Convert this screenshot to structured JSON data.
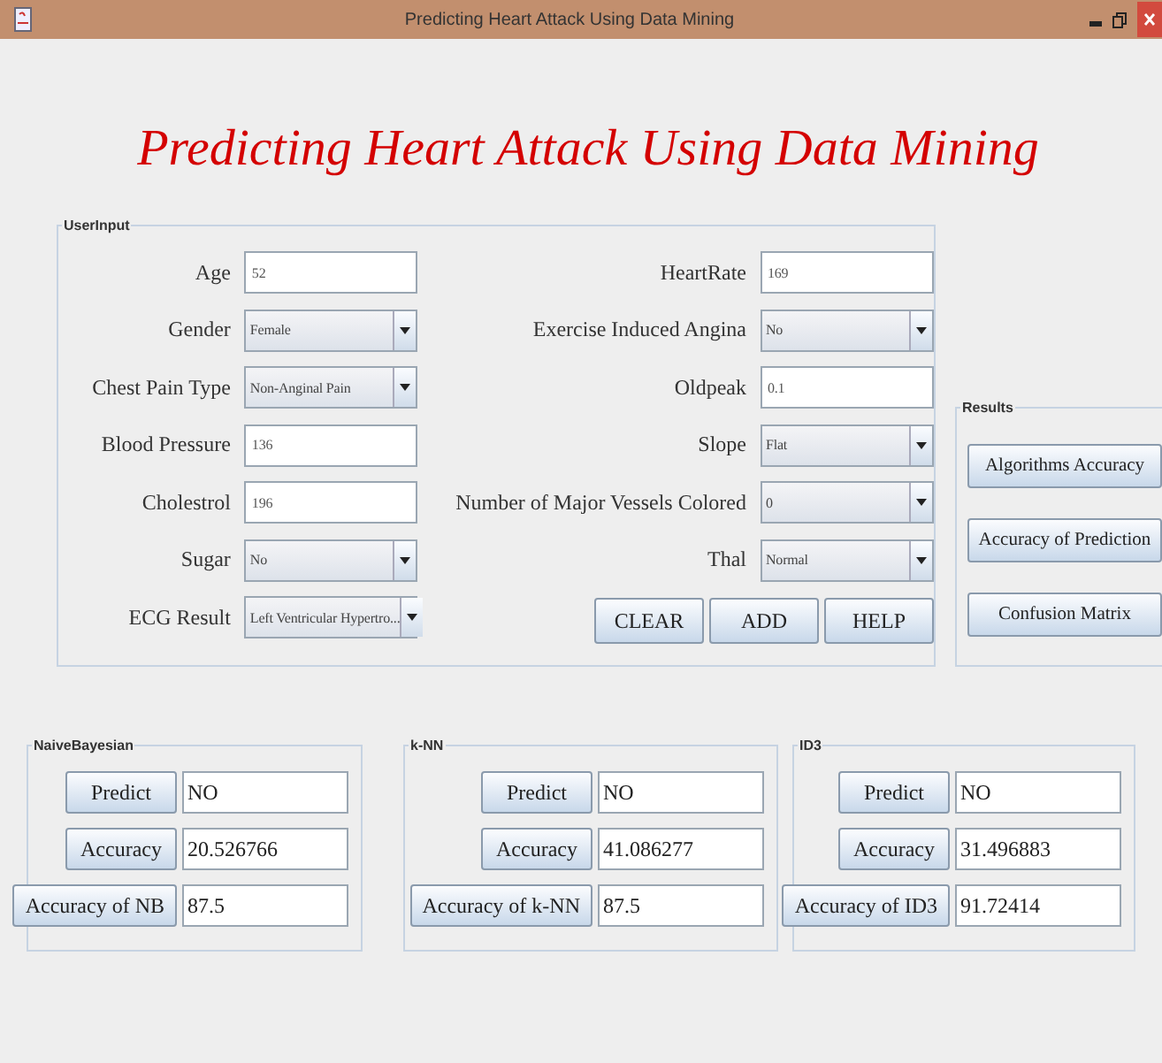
{
  "window": {
    "title": "Predicting Heart Attack Using Data Mining"
  },
  "heading": "Predicting Heart Attack Using Data Mining",
  "user_input": {
    "legend": "UserInput",
    "left_fields": [
      {
        "label": "Age",
        "kind": "text",
        "value": "52"
      },
      {
        "label": "Gender",
        "kind": "select",
        "value": "Female"
      },
      {
        "label": "Chest Pain Type",
        "kind": "select",
        "value": "Non-Anginal Pain"
      },
      {
        "label": "Blood Pressure",
        "kind": "text",
        "value": "136"
      },
      {
        "label": "Cholestrol",
        "kind": "text",
        "value": "196"
      },
      {
        "label": "Sugar",
        "kind": "select",
        "value": "No"
      },
      {
        "label": "ECG Result",
        "kind": "select",
        "value": "Left Ventricular Hypertro..."
      }
    ],
    "right_fields": [
      {
        "label": "HeartRate",
        "kind": "text",
        "value": "169"
      },
      {
        "label": "Exercise Induced Angina",
        "kind": "select",
        "value": "No"
      },
      {
        "label": "Oldpeak",
        "kind": "text",
        "value": "0.1"
      },
      {
        "label": "Slope",
        "kind": "select",
        "value": "Flat"
      },
      {
        "label": "Number of Major Vessels Colored",
        "kind": "select",
        "value": "0"
      },
      {
        "label": "Thal",
        "kind": "select",
        "value": "Normal"
      }
    ],
    "buttons": [
      "CLEAR",
      "ADD",
      "HELP"
    ]
  },
  "results": {
    "legend": "Results",
    "buttons": [
      "Algorithms Accuracy",
      "Accuracy of Prediction",
      "Confusion Matrix"
    ]
  },
  "classifiers": [
    {
      "legend": "NaiveBayesian",
      "rows": [
        {
          "button": "Predict",
          "value": "NO"
        },
        {
          "button": "Accuracy",
          "value": "20.526766"
        },
        {
          "button": "Accuracy of NB",
          "value": "87.5"
        }
      ]
    },
    {
      "legend": "k-NN",
      "rows": [
        {
          "button": "Predict",
          "value": "NO"
        },
        {
          "button": "Accuracy",
          "value": "41.086277"
        },
        {
          "button": "Accuracy of k-NN",
          "value": "87.5"
        }
      ]
    },
    {
      "legend": "ID3",
      "rows": [
        {
          "button": "Predict",
          "value": "NO"
        },
        {
          "button": "Accuracy",
          "value": "31.496883"
        },
        {
          "button": "Accuracy of ID3",
          "value": "91.72414"
        }
      ]
    }
  ]
}
